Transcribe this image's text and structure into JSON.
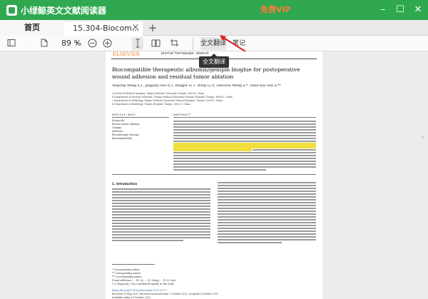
{
  "app": {
    "title": "小绿鲸英文文献阅读器",
    "promo": "免费VIP"
  },
  "window_controls": {
    "minimize": "–",
    "maximize": "☐",
    "close": "✕"
  },
  "tabs": {
    "home_label": "首页",
    "doc_label": "15.304-Biocom...",
    "doc_close": "×",
    "add": "+"
  },
  "toolbar": {
    "zoom_value": "89 %",
    "zoom_dropdown": "▾",
    "translate_label": "全文翻译",
    "notes_label": "笔记",
    "tooltip": "全文翻译"
  },
  "colors": {
    "titlebar": "#2fa84f",
    "promo": "#ff7a3c",
    "annotation_arrow": "#e02020",
    "highlight": "#f0df3c"
  },
  "icons": [
    "sidebar-toggle-icon",
    "file-icon",
    "zoom-out-icon",
    "zoom-in-icon",
    "text-select-icon",
    "book-view-icon",
    "screenshot-icon",
    "scroll-right-icon"
  ],
  "document": {
    "publisher": "ELSEVIER",
    "journal_home": "journal homepage: www.el",
    "title": "Biocompatible therapeutic albumin/genipin bioglue for postoperative wound adhesion and residual tumor ablation",
    "authors": "Yaqiong Wang a,1, Jingjing Guo b,1, Bingjie Li c, Dong Li d, Zhaowei Meng a,*, Shao-Kai Sun a,**",
    "affiliations": [
      "a School of Medical Imaging, Tianjin Medical University, Tianjin, 300203, China",
      "b Department of Nuclear Medicine, Tianjin Medical University General Hospital, Tianjin, 300052, China",
      "c Department of Radiology, Tianjin Medical University General Hospital, Tianjin, 300052, China",
      "d Department of Radiology, Tianjin Hospital, Tianjin, 300211, China"
    ],
    "article_info_heading": "ARTICLE INFO",
    "abstract_heading": "ABSTRACT",
    "keywords_title": "Keywords:",
    "keywords": [
      "Bovine serum albumin",
      "Genipin",
      "Adhesive",
      "Photothermal therapy",
      "Biocompatibility"
    ],
    "intro_heading": "1. Introduction",
    "footnotes": {
      "star1": "* Corresponding author.",
      "star2": "** Corresponding author.",
      "star3": "*** Corresponding author.",
      "email": "E-mail addresses: ... (D. Li), ... (Z. Meng), ... (S.-K. Sun).",
      "equal": "1 Y. Wang and J. Guo contributed equally to this work.",
      "doi": "https://doi.org/10.1016/j.bioactmat.2021.10.???",
      "received": "Received 20 May 2021; Received in revised form 1 October 2021; Accepted 6 October 2021",
      "available": "Available online 13 October 2021"
    }
  }
}
